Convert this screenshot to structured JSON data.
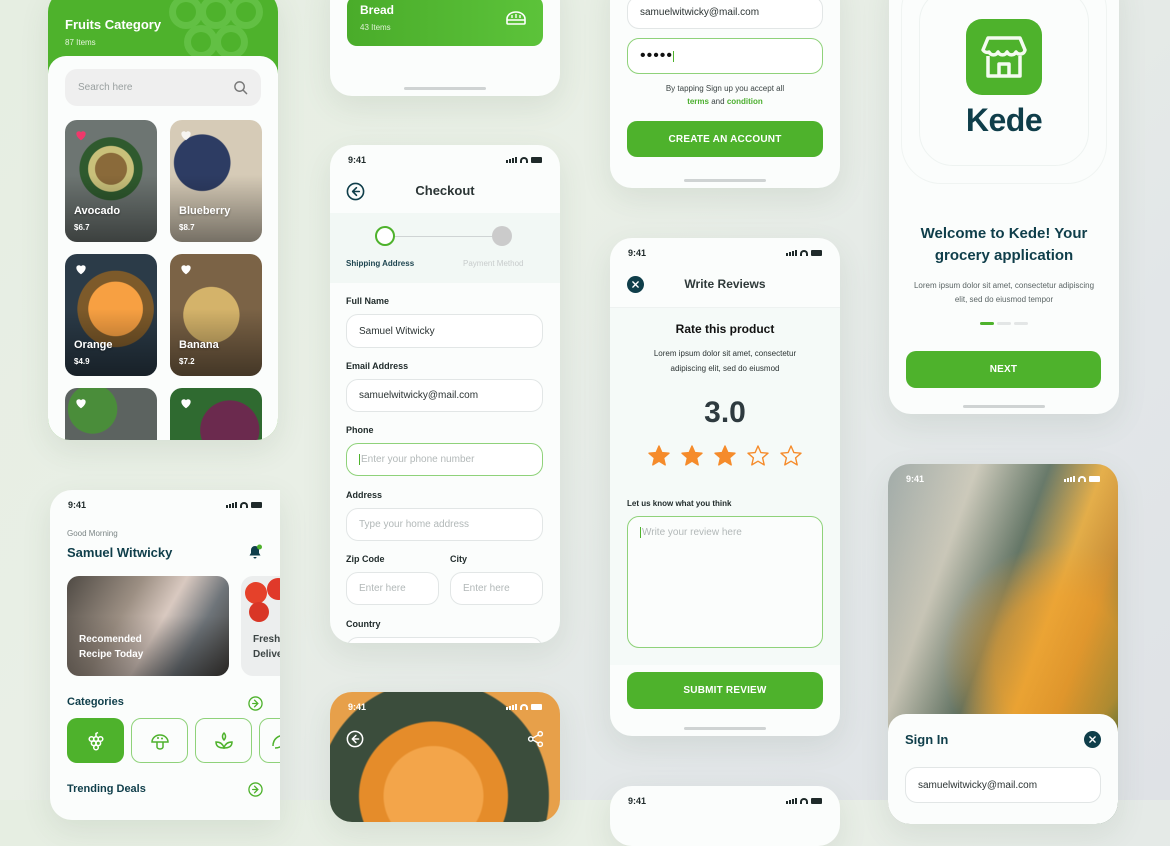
{
  "fruits_screen": {
    "title": "Fruits Category",
    "count": "87 Items",
    "search_placeholder": "Search here",
    "items": [
      {
        "name": "Avocado",
        "price": "$6.7",
        "favorite": true
      },
      {
        "name": "Blueberry",
        "price": "$8.7",
        "favorite": false
      },
      {
        "name": "Orange",
        "price": "$4.9",
        "favorite": false
      },
      {
        "name": "Banana",
        "price": "$7.2",
        "favorite": false
      },
      {
        "name": "",
        "price": "",
        "favorite": false
      },
      {
        "name": "",
        "price": "",
        "favorite": false
      }
    ]
  },
  "bread_screen": {
    "category_title": "Bread",
    "category_count": "43 Items"
  },
  "checkout_screen": {
    "time": "9:41",
    "title": "Checkout",
    "steps": [
      {
        "label": "Shipping Address",
        "active": true
      },
      {
        "label": "Payment Method",
        "active": false
      }
    ],
    "fields": {
      "full_name_label": "Full Name",
      "full_name_value": "Samuel Witwicky",
      "email_label": "Email Address",
      "email_value": "samuelwitwicky@mail.com",
      "phone_label": "Phone",
      "phone_placeholder": "Enter your phone number",
      "address_label": "Address",
      "address_placeholder": "Type your home address",
      "zip_label": "Zip Code",
      "zip_placeholder": "Enter here",
      "city_label": "City",
      "city_placeholder": "Enter here",
      "country_label": "Country"
    }
  },
  "signup_screen": {
    "email_value": "samuelwitwicky@mail.com",
    "password_mask": "•••••",
    "terms_prefix": "By tapping Sign up you accept all",
    "terms_link": "terms",
    "and_text": "and",
    "condition_link": "condition",
    "create_button": "CREATE AN ACCOUNT"
  },
  "review_screen": {
    "time": "9:41",
    "title": "Write Reviews",
    "rate_title": "Rate this product",
    "rate_desc": "Lorem ipsum dolor sit amet, consectetur adipiscing elit, sed do eiusmod",
    "rating_value": "3.0",
    "rating": 3,
    "rating_max": 5,
    "feedback_label": "Let us know what you think",
    "feedback_placeholder": "Write your review here",
    "submit_button": "SUBMIT REVIEW"
  },
  "review_screen_2": {
    "time": "9:41"
  },
  "onboarding_screen": {
    "brand": "Kede",
    "headline": "Welcome to Kede! Your grocery application",
    "desc": "Lorem ipsum dolor sit amet, consectetur adipiscing elit, sed do eiusmod tempor",
    "page_index": 1,
    "page_total": 3,
    "next_button": "NEXT"
  },
  "home_screen": {
    "time": "9:41",
    "greeting": "Good Morning",
    "user_name": "Samuel Witwicky",
    "banners": [
      {
        "line1": "Recomended",
        "line2": "Recipe Today"
      },
      {
        "line1": "Fresh",
        "line2": "Delive"
      }
    ],
    "categories_title": "Categories",
    "categories": [
      {
        "icon": "grapes-icon",
        "active": true
      },
      {
        "icon": "mushroom-icon",
        "active": false
      },
      {
        "icon": "leaf-sprout-icon",
        "active": false
      },
      {
        "icon": "leaf-icon",
        "active": false
      }
    ],
    "trending_title": "Trending Deals"
  },
  "product_screen": {
    "time": "9:41"
  },
  "signin_screen": {
    "time": "9:41",
    "title": "Sign In",
    "email_value": "samuelwitwicky@mail.com"
  },
  "colors": {
    "brand_green": "#4eb22c",
    "dark_teal": "#0f3e4a",
    "star_orange": "#f58b2b",
    "heart_pink": "#f0386b"
  }
}
